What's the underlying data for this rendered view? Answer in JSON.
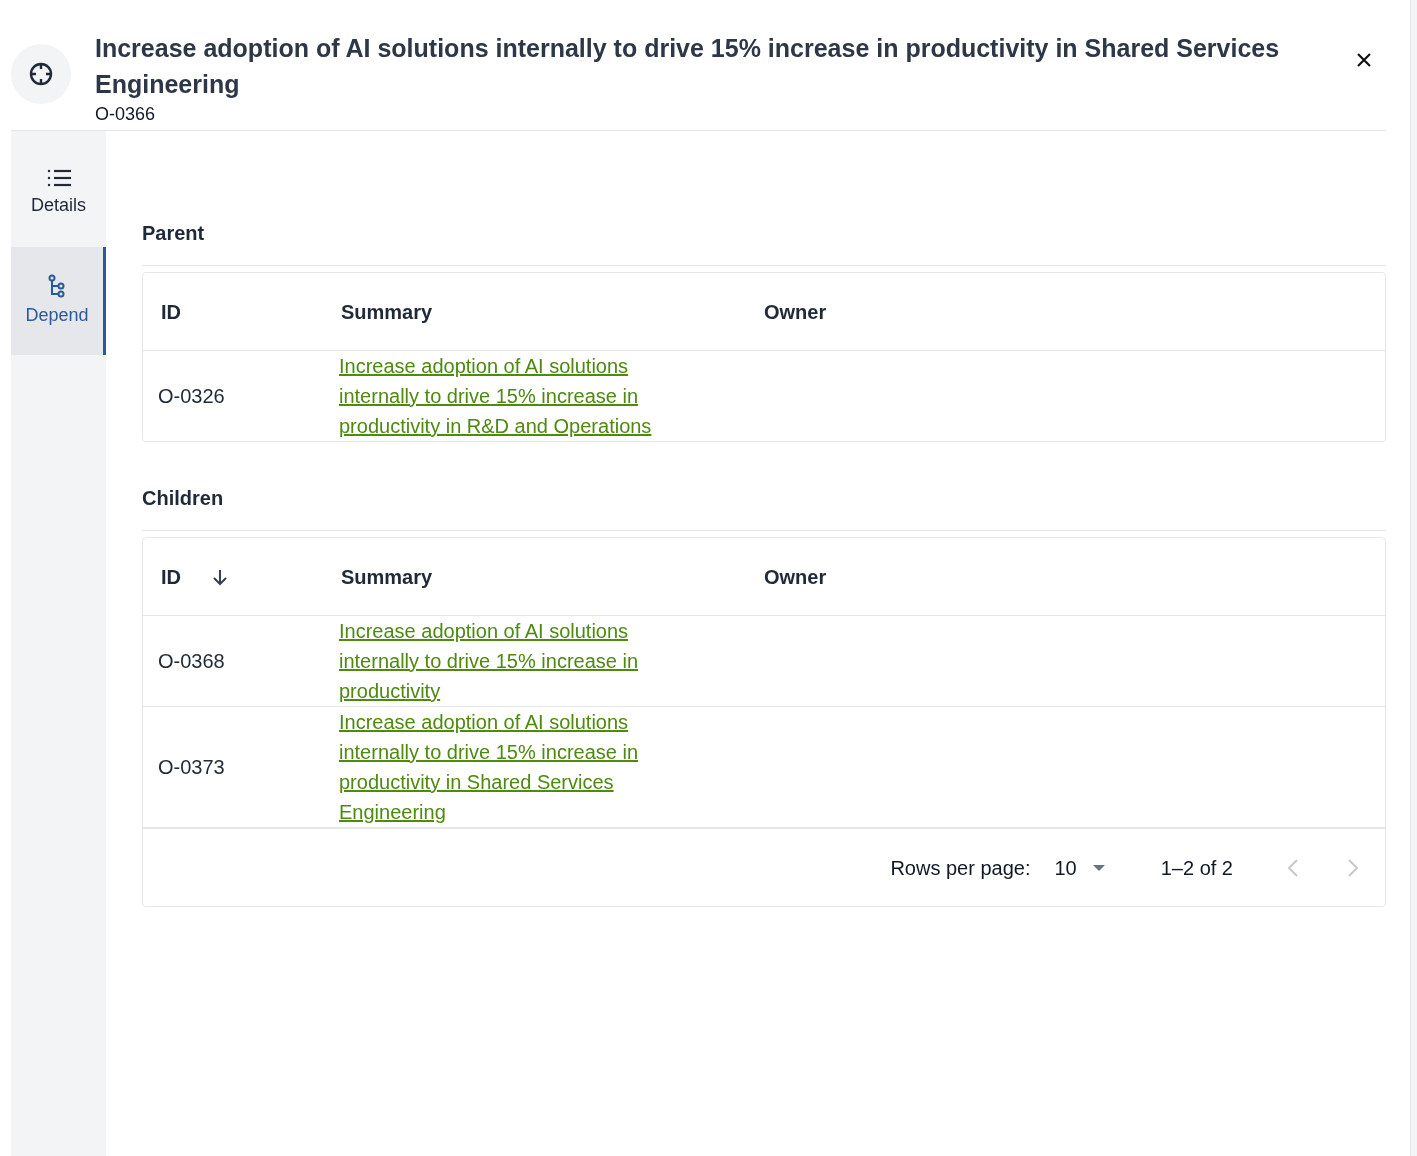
{
  "header": {
    "title": "Increase adoption of AI solutions internally to drive 15% increase in productivity in Shared Services Engineering",
    "id": "O-0366"
  },
  "sidebar": {
    "items": [
      {
        "kind": "list",
        "label": "Details",
        "selected": false
      },
      {
        "kind": "tree",
        "label": "Depend",
        "selected": true
      }
    ]
  },
  "sections": [
    {
      "title": "Parent",
      "columns": [
        {
          "label": "ID",
          "sorted": false
        },
        {
          "label": "Summary",
          "sorted": false
        },
        {
          "label": "Owner",
          "sorted": false
        }
      ],
      "rows": [
        {
          "id": "O-0326",
          "summary": "Increase adoption of AI solutions internally to drive 15% increase in productivity in R&D and Operations"
        }
      ]
    },
    {
      "title": "Children",
      "columns": [
        {
          "label": "ID",
          "sorted": true
        },
        {
          "label": "Summary",
          "sorted": false
        },
        {
          "label": "Owner",
          "sorted": false
        }
      ],
      "rows": [
        {
          "id": "O-0368",
          "summary": "Increase adoption of AI solutions internally to drive 15% increase in productivity"
        },
        {
          "id": "O-0373",
          "summary": "Increase adoption of AI solutions internally to drive 15% increase in productivity in Shared Services Engineering"
        }
      ],
      "pagination": {
        "rows_label": "Rows per page:",
        "rows_value": "10",
        "range": "1–2 of 2",
        "prev_disabled": true,
        "next_disabled": true
      }
    }
  ]
}
